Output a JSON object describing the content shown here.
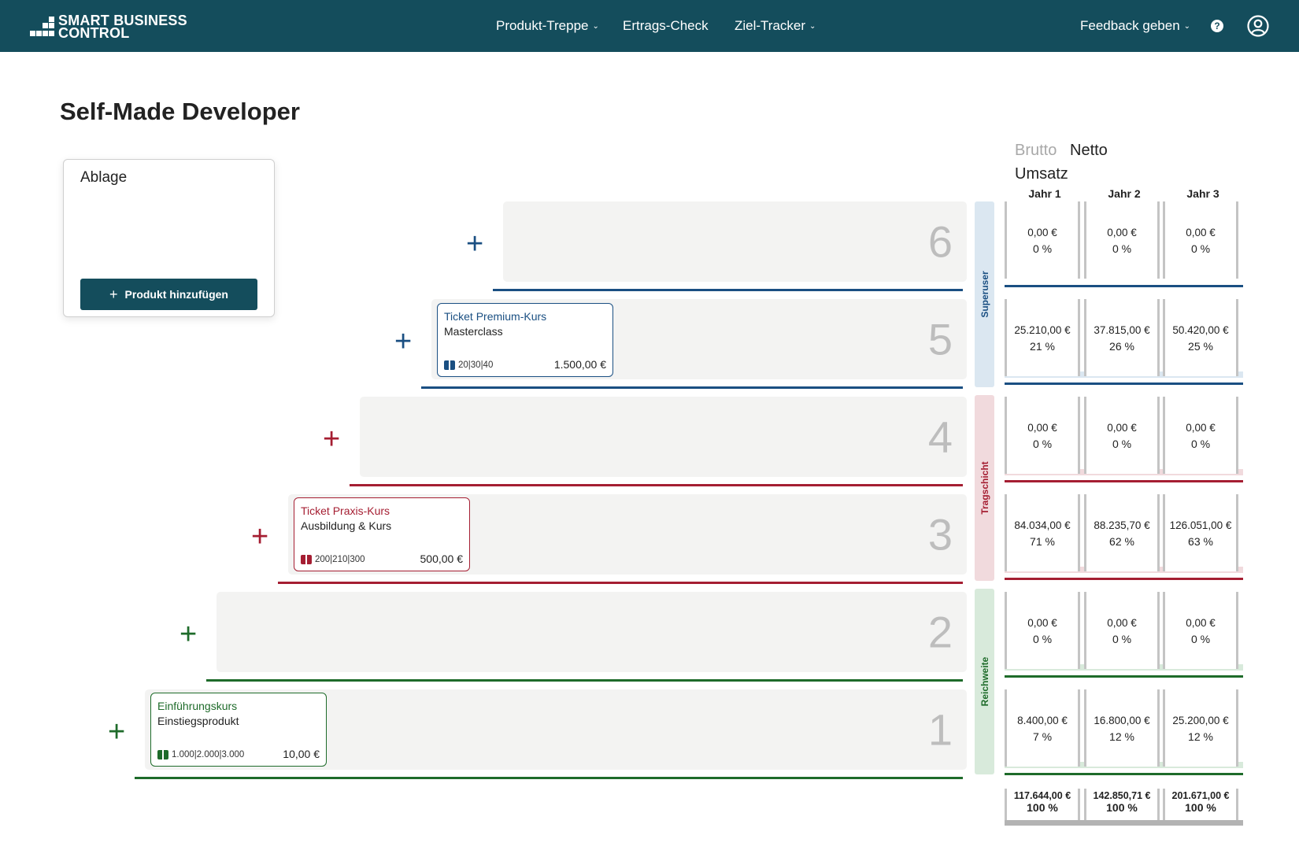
{
  "header": {
    "logo_line1": "SMART BUSINESS",
    "logo_line2": "CONTROL",
    "nav": [
      {
        "label": "Produkt-Treppe",
        "dropdown": true
      },
      {
        "label": "Ertrags-Check",
        "dropdown": false
      },
      {
        "label": "Ziel-Tracker",
        "dropdown": true
      }
    ],
    "feedback_label": "Feedback geben",
    "help_icon": "help-icon",
    "user_icon": "user-account-icon",
    "bg_color": "#144d5c"
  },
  "page_title": "Self-Made Developer",
  "ablage": {
    "title": "Ablage",
    "add_button": "Produkt hinzufügen"
  },
  "colors": {
    "blue": "#1a4f82",
    "red": "#a51e32",
    "green": "#1e6b2a",
    "blue_light": "#dbe7f1",
    "red_light": "#f1dadd",
    "green_light": "#d8eadb"
  },
  "steps": [
    {
      "number": "6"
    },
    {
      "number": "5"
    },
    {
      "number": "4"
    },
    {
      "number": "3"
    },
    {
      "number": "2"
    },
    {
      "number": "1"
    }
  ],
  "cards": {
    "premium": {
      "title": "Ticket Premium-Kurs",
      "subtitle": "Masterclass",
      "units": "20|30|40",
      "price": "1.500,00 €"
    },
    "praxis": {
      "title": "Ticket Praxis-Kurs",
      "subtitle": "Ausbildung & Kurs",
      "units": "200|210|300",
      "price": "500,00 €"
    },
    "einfuehrung": {
      "title": "Einführungskurs",
      "subtitle": "Einstiegsprodukt",
      "units": "1.000|2.000|3.000",
      "price": "10,00 €"
    }
  },
  "tiers": {
    "superuser": "Superuser",
    "tragschicht": "Tragschicht",
    "reichweite": "Reichweite"
  },
  "umsatz": {
    "toggle_brutto": "Brutto",
    "toggle_netto": "Netto",
    "title": "Umsatz",
    "columns": [
      "Jahr 1",
      "Jahr 2",
      "Jahr 3"
    ],
    "rows": [
      {
        "step": "6",
        "values": [
          [
            "0,00 €",
            "0 %"
          ],
          [
            "0,00 €",
            "0 %"
          ],
          [
            "0,00 €",
            "0 %"
          ]
        ]
      },
      {
        "step": "5",
        "values": [
          [
            "25.210,00 €",
            "21 %"
          ],
          [
            "37.815,00 €",
            "26 %"
          ],
          [
            "50.420,00 €",
            "25 %"
          ]
        ]
      },
      {
        "step": "4",
        "values": [
          [
            "0,00 €",
            "0 %"
          ],
          [
            "0,00 €",
            "0 %"
          ],
          [
            "0,00 €",
            "0 %"
          ]
        ]
      },
      {
        "step": "3",
        "values": [
          [
            "84.034,00 €",
            "71 %"
          ],
          [
            "88.235,70 €",
            "62 %"
          ],
          [
            "126.051,00 €",
            "63 %"
          ]
        ]
      },
      {
        "step": "2",
        "values": [
          [
            "0,00 €",
            "0 %"
          ],
          [
            "0,00 €",
            "0 %"
          ],
          [
            "0,00 €",
            "0 %"
          ]
        ]
      },
      {
        "step": "1",
        "values": [
          [
            "8.400,00 €",
            "7 %"
          ],
          [
            "16.800,00 €",
            "12 %"
          ],
          [
            "25.200,00 €",
            "12 %"
          ]
        ]
      }
    ],
    "totals": [
      [
        "117.644,00 €",
        "100 %"
      ],
      [
        "142.850,71 €",
        "100 %"
      ],
      [
        "201.671,00 €",
        "100 %"
      ]
    ]
  }
}
